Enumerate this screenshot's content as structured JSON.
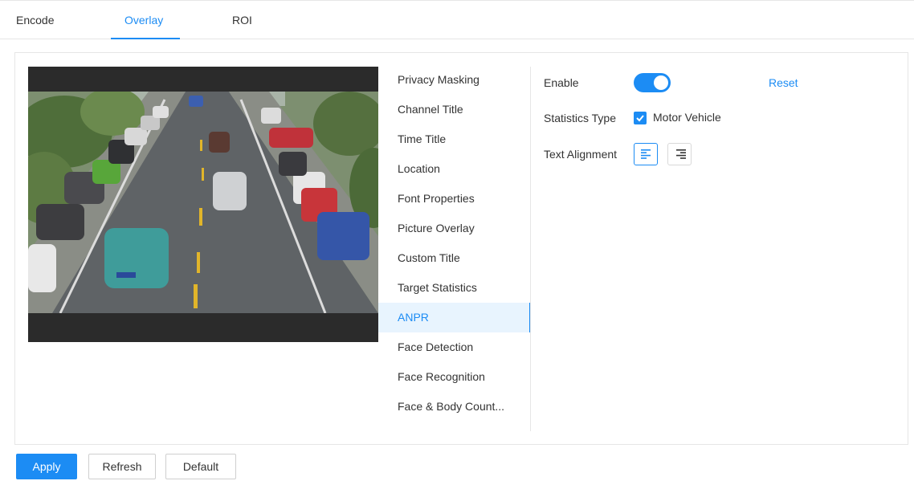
{
  "tabs": [
    {
      "label": "Encode",
      "active": false
    },
    {
      "label": "Overlay",
      "active": true
    },
    {
      "label": "ROI",
      "active": false
    }
  ],
  "menu": {
    "items": [
      {
        "label": "Privacy Masking"
      },
      {
        "label": "Channel Title"
      },
      {
        "label": "Time Title"
      },
      {
        "label": "Location"
      },
      {
        "label": "Font Properties"
      },
      {
        "label": "Picture Overlay"
      },
      {
        "label": "Custom Title"
      },
      {
        "label": "Target Statistics"
      },
      {
        "label": "ANPR"
      },
      {
        "label": "Face Detection"
      },
      {
        "label": "Face Recognition"
      },
      {
        "label": "Face & Body Count..."
      }
    ],
    "active_index": 8
  },
  "settings": {
    "enable_label": "Enable",
    "enable_on": true,
    "reset_label": "Reset",
    "statistics_type_label": "Statistics Type",
    "motor_vehicle_label": "Motor Vehicle",
    "motor_vehicle_checked": true,
    "text_alignment_label": "Text Alignment",
    "alignment_selected": "left"
  },
  "buttons": {
    "apply": "Apply",
    "refresh": "Refresh",
    "default": "Default"
  },
  "colors": {
    "accent": "#1c8cf4",
    "active_bg": "#e8f4fe",
    "preview_bg": "#2b2b2b"
  }
}
